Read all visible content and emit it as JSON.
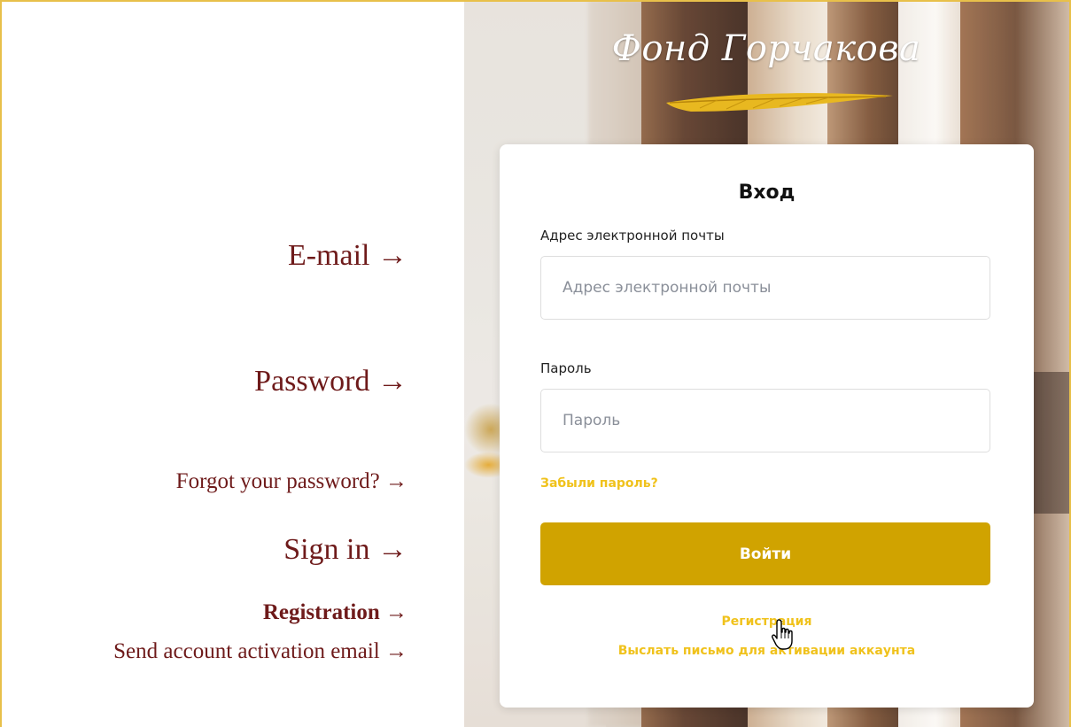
{
  "annotations": {
    "email": "E-mail →",
    "password": "Password →",
    "forgot": "Forgot your password? →",
    "signin": "Sign in →",
    "registration": "Registration →",
    "activation": "Send account activation email →"
  },
  "logo": {
    "text": "Фонд Горчакова",
    "icon": "golden-feather-icon"
  },
  "login": {
    "title": "Вход",
    "email_label": "Адрес электронной почты",
    "email_placeholder": "Адрес электронной почты",
    "email_value": "",
    "password_label": "Пароль",
    "password_placeholder": "Пароль",
    "password_value": "",
    "forgot_link": "Забыли пароль?",
    "signin_button": "Войти",
    "register_link": "Регистрация",
    "activation_link": "Выслать письмо для активации аккаунта"
  },
  "cursor": {
    "icon": "hand-pointer-icon"
  },
  "colors": {
    "accent": "#d0a300",
    "link": "#f0c21c",
    "annotation": "#6e1a1a",
    "frame": "#e8c04a"
  }
}
